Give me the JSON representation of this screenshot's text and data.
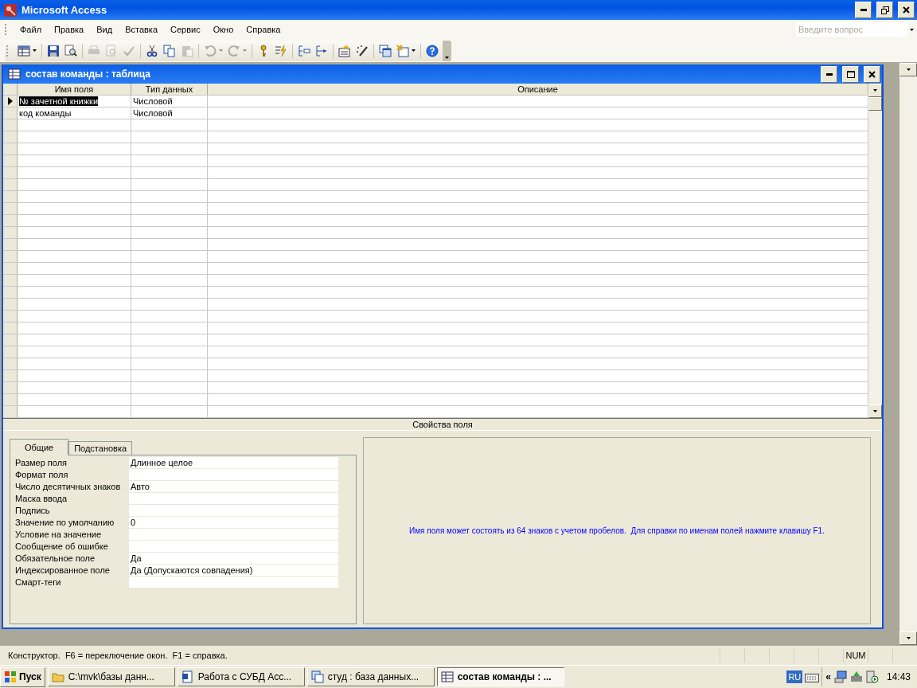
{
  "app": {
    "title": "Microsoft Access"
  },
  "menu": [
    {
      "label": "Файл"
    },
    {
      "label": "Правка"
    },
    {
      "label": "Вид"
    },
    {
      "label": "Вставка"
    },
    {
      "label": "Сервис"
    },
    {
      "label": "Окно"
    },
    {
      "label": "Справка"
    }
  ],
  "toolbar": {
    "groups": [
      {
        "buttons": [
          {
            "kind": "table",
            "disabled": false,
            "dropdown": true
          }
        ]
      },
      {
        "buttons": [
          {
            "kind": "save",
            "disabled": false,
            "dropdown": false
          },
          {
            "kind": "search",
            "disabled": false,
            "dropdown": false
          }
        ]
      },
      {
        "buttons": [
          {
            "kind": "print",
            "disabled": true,
            "dropdown": false
          },
          {
            "kind": "preview",
            "disabled": true,
            "dropdown": false
          },
          {
            "kind": "spelling",
            "disabled": true,
            "dropdown": false
          }
        ]
      },
      {
        "buttons": [
          {
            "kind": "cut",
            "disabled": false,
            "dropdown": false
          },
          {
            "kind": "copy",
            "disabled": false,
            "dropdown": false
          },
          {
            "kind": "paste",
            "disabled": true,
            "dropdown": false
          }
        ]
      },
      {
        "buttons": [
          {
            "kind": "undo",
            "disabled": true,
            "dropdown": true
          },
          {
            "kind": "redo",
            "disabled": true,
            "dropdown": true
          }
        ]
      },
      {
        "buttons": [
          {
            "kind": "key",
            "disabled": false,
            "dropdown": false
          },
          {
            "kind": "lightning",
            "disabled": false,
            "dropdown": false
          }
        ]
      },
      {
        "buttons": [
          {
            "kind": "insert_rows",
            "disabled": false,
            "dropdown": false
          },
          {
            "kind": "delete_rows",
            "disabled": false,
            "dropdown": false
          }
        ]
      },
      {
        "buttons": [
          {
            "kind": "properties",
            "disabled": false,
            "dropdown": false
          },
          {
            "kind": "wand",
            "disabled": false,
            "dropdown": false
          }
        ]
      },
      {
        "buttons": [
          {
            "kind": "windows",
            "disabled": false,
            "dropdown": false
          },
          {
            "kind": "new_object",
            "disabled": false,
            "dropdown": true
          }
        ]
      },
      {
        "buttons": [
          {
            "kind": "help",
            "disabled": false,
            "dropdown": false
          }
        ]
      }
    ]
  },
  "question_box": {
    "placeholder": "Введите вопрос"
  },
  "table_window": {
    "title": "состав команды : таблица"
  },
  "grid": {
    "columns": [
      "Имя поля",
      "Тип данных",
      "Описание"
    ],
    "rows": [
      {
        "field_name": "№ зачетной книжки",
        "data_type": "Числовой",
        "selected": true
      },
      {
        "field_name": "код команды",
        "data_type": "Числовой",
        "selected": false
      }
    ]
  },
  "field_properties": {
    "title": "Свойства поля",
    "tabs": [
      {
        "label": "Общие",
        "selected": true
      },
      {
        "label": "Подстановка",
        "selected": false
      }
    ],
    "properties": [
      {
        "label": "Размер поля",
        "value": "Длинное целое"
      },
      {
        "label": "Формат поля"
      },
      {
        "label": "Число десятичных знаков",
        "value": "Авто"
      },
      {
        "label": "Маска ввода"
      },
      {
        "label": "Подпись"
      },
      {
        "label": "Значение по умолчанию",
        "value": "0"
      },
      {
        "label": "Условие на значение"
      },
      {
        "label": "Сообщение об ошибке"
      },
      {
        "label": "Обязательное поле",
        "value": "Да"
      },
      {
        "label": "Индексированное поле",
        "value": "Да (Допускаются совпадения)"
      },
      {
        "label": "Смарт-теги"
      }
    ],
    "hint": "Имя поля может состоять из 64 знаков с учетом пробелов.  Для справки по именам полей нажмите клавишу F1."
  },
  "status_bar": {
    "text": "Конструктор.  F6 = переключение окон.  F1 = справка.",
    "indicator": "NUM"
  },
  "taskbar": {
    "start": "Пуск",
    "tasks": [
      {
        "kind": "folder",
        "label": "C:\\mvk\\базы данн...",
        "selected": false
      },
      {
        "kind": "document",
        "label": "Работа с СУБД Acc...",
        "selected": false
      },
      {
        "kind": "database",
        "label": "студ : база данных...",
        "selected": false
      },
      {
        "kind": "table",
        "label": "состав команды : ...",
        "selected": true
      }
    ],
    "language": "RU",
    "tray_toggle": "«",
    "clock": "14:43"
  }
}
